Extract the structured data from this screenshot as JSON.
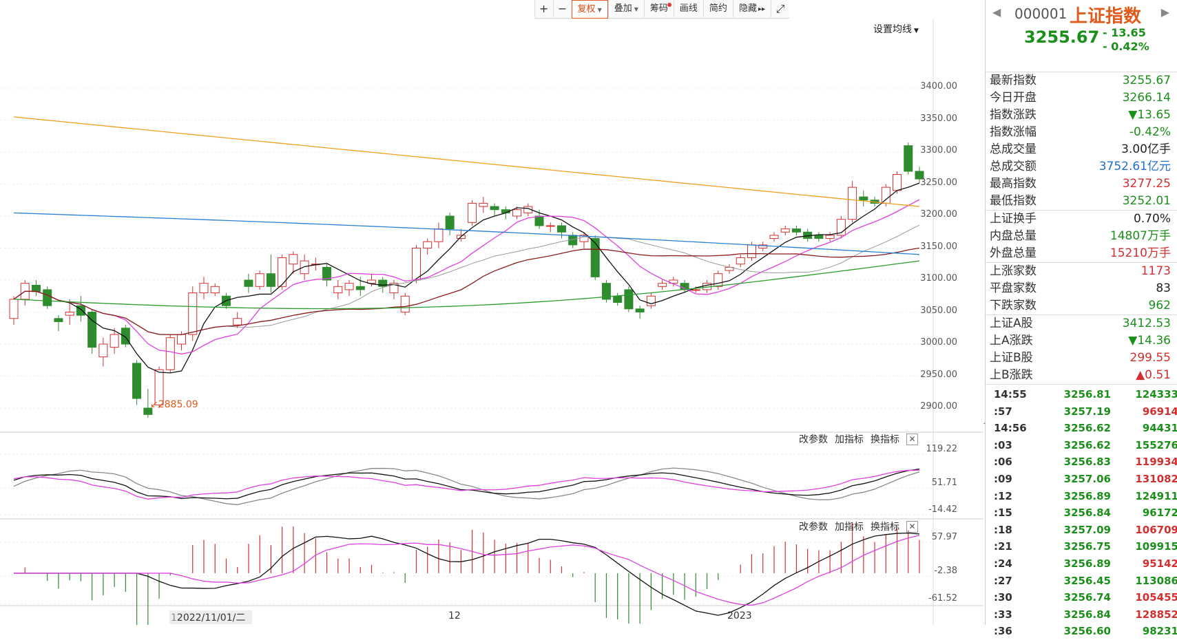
{
  "toolbar": {
    "plus": "+",
    "minus": "−",
    "items": [
      "复权",
      "叠加",
      "筹码",
      "画线",
      "简约",
      "隐藏"
    ],
    "more": "▸▸",
    "fullscreen": "⤢"
  },
  "ma_setting": "设置均线",
  "low_label": "2885.09",
  "main_axis": [
    "3400.00",
    "3350.00",
    "3300.00",
    "3250.00",
    "3200.00",
    "3150.00",
    "3100.00",
    "3050.00",
    "3000.00",
    "2950.00",
    "2900.00"
  ],
  "sub1": {
    "actions": [
      "改参数",
      "加指标",
      "换指标"
    ],
    "close": "✕",
    "axis": [
      "119.22",
      "51.71",
      "-14.42"
    ]
  },
  "sub2": {
    "actions": [
      "改参数",
      "加指标",
      "换指标"
    ],
    "close": "✕",
    "axis": [
      "57.97",
      "-2.38",
      "-61.52"
    ]
  },
  "dates": {
    "d1": "2022/11/01/二",
    "d2": "12",
    "d3": "2023",
    "d1_prefix": "1"
  },
  "side": {
    "code": "000001",
    "name": "上证指数",
    "price": "3255.67",
    "change": "- 13.65",
    "change_pct": "- 0.42%",
    "groups": [
      [
        {
          "label": "最新指数",
          "value": "3255.67",
          "color": "green"
        },
        {
          "label": "今日开盘",
          "value": "3266.14",
          "color": "green"
        },
        {
          "label": "指数涨跌",
          "value": "▼13.65",
          "color": "green"
        },
        {
          "label": "指数涨幅",
          "value": "-0.42%",
          "color": "green"
        },
        {
          "label": "总成交量",
          "value": "3.00亿手",
          "color": "dark"
        },
        {
          "label": "总成交额",
          "value": "3752.61亿元",
          "color": "blue"
        },
        {
          "label": "最高指数",
          "value": "3277.25",
          "color": "red"
        },
        {
          "label": "最低指数",
          "value": "3252.01",
          "color": "green"
        }
      ],
      [
        {
          "label": "上证换手",
          "value": "0.70%",
          "color": "dark"
        },
        {
          "label": "内盘总量",
          "value": "14807万手",
          "color": "green"
        },
        {
          "label": "外盘总量",
          "value": "15210万手",
          "color": "red"
        }
      ],
      [
        {
          "label": "上涨家数",
          "value": "1173",
          "color": "red"
        },
        {
          "label": "平盘家数",
          "value": "83",
          "color": "dark"
        },
        {
          "label": "下跌家数",
          "value": "962",
          "color": "green"
        }
      ],
      [
        {
          "label": "上证A股",
          "value": "3412.53",
          "color": "green"
        },
        {
          "label": "上A涨跌",
          "value": "▼14.36",
          "color": "green"
        },
        {
          "label": "上证B股",
          "value": "299.55",
          "color": "red"
        },
        {
          "label": "上B涨跌",
          "value": "▲0.51",
          "color": "red"
        }
      ]
    ],
    "ticks": [
      {
        "t": "14:55",
        "p": "3256.81",
        "v": "124333",
        "c": "green"
      },
      {
        "t": ":57",
        "p": "3257.19",
        "v": "96914",
        "c": "red"
      },
      {
        "t": "14:56",
        "p": "3256.62",
        "v": "94431",
        "c": "green"
      },
      {
        "t": ":03",
        "p": "3256.62",
        "v": "155276",
        "c": "green"
      },
      {
        "t": ":06",
        "p": "3256.83",
        "v": "119934",
        "c": "red"
      },
      {
        "t": ":09",
        "p": "3257.06",
        "v": "131082",
        "c": "red"
      },
      {
        "t": ":12",
        "p": "3256.89",
        "v": "124911",
        "c": "green"
      },
      {
        "t": ":15",
        "p": "3256.84",
        "v": "96172",
        "c": "green"
      },
      {
        "t": ":18",
        "p": "3257.09",
        "v": "106709",
        "c": "red"
      },
      {
        "t": ":21",
        "p": "3256.75",
        "v": "109915",
        "c": "green"
      },
      {
        "t": ":24",
        "p": "3256.89",
        "v": "95142",
        "c": "red"
      },
      {
        "t": ":27",
        "p": "3256.45",
        "v": "113086",
        "c": "green"
      },
      {
        "t": ":30",
        "p": "3256.74",
        "v": "105455",
        "c": "red"
      },
      {
        "t": ":33",
        "p": "3256.84",
        "v": "128852",
        "c": "red"
      },
      {
        "t": ":36",
        "p": "3256.60",
        "v": "98231",
        "c": "green"
      }
    ]
  },
  "colors": {
    "up": "#d32f2f",
    "down": "#2e8b2e",
    "ma5": "#111111",
    "ma10": "#e040e0",
    "ma20": "#999999",
    "ma30": "#8b1a1a",
    "ma60": "#2a9a2a",
    "ma120": "#2a7fd4",
    "ma250": "#f0a020"
  },
  "chart_data": {
    "type": "candlestick",
    "ylim": [
      2880,
      3420
    ],
    "candles": [
      [
        3040,
        3070,
        3030,
        3075
      ],
      [
        3070,
        3095,
        3060,
        3100
      ],
      [
        3092,
        3082,
        3075,
        3100
      ],
      [
        3085,
        3060,
        3055,
        3090
      ],
      [
        3040,
        3035,
        3020,
        3045
      ],
      [
        3045,
        3050,
        3030,
        3070
      ],
      [
        3060,
        3045,
        3035,
        3075
      ],
      [
        3050,
        2995,
        2985,
        3055
      ],
      [
        2980,
        3000,
        2965,
        3010
      ],
      [
        2995,
        3015,
        2985,
        3025
      ],
      [
        3025,
        3000,
        2995,
        3030
      ],
      [
        2970,
        2915,
        2905,
        2975
      ],
      [
        2900,
        2890,
        2885,
        2930
      ],
      [
        2905,
        2960,
        2900,
        2965
      ],
      [
        2960,
        3010,
        2955,
        3015
      ],
      [
        3000,
        3015,
        2990,
        3020
      ],
      [
        3015,
        3080,
        3005,
        3090
      ],
      [
        3080,
        3095,
        3070,
        3105
      ],
      [
        3080,
        3090,
        3075,
        3095
      ],
      [
        3075,
        3060,
        3055,
        3080
      ],
      [
        3030,
        3040,
        3025,
        3050
      ],
      [
        3100,
        3090,
        3080,
        3110
      ],
      [
        3090,
        3110,
        3085,
        3115
      ],
      [
        3110,
        3090,
        3080,
        3140
      ],
      [
        3090,
        3135,
        3085,
        3140
      ],
      [
        3125,
        3140,
        3110,
        3145
      ],
      [
        3110,
        3130,
        3100,
        3140
      ],
      [
        3125,
        3125,
        3115,
        3135
      ],
      [
        3120,
        3100,
        3090,
        3125
      ],
      [
        3080,
        3090,
        3070,
        3100
      ],
      [
        3085,
        3095,
        3075,
        3100
      ],
      [
        3090,
        3085,
        3075,
        3105
      ],
      [
        3095,
        3100,
        3090,
        3110
      ],
      [
        3100,
        3090,
        3080,
        3105
      ],
      [
        3080,
        3095,
        3070,
        3100
      ],
      [
        3050,
        3075,
        3045,
        3080
      ],
      [
        3100,
        3150,
        3095,
        3155
      ],
      [
        3150,
        3160,
        3140,
        3165
      ],
      [
        3160,
        3180,
        3150,
        3190
      ],
      [
        3200,
        3180,
        3170,
        3205
      ],
      [
        3165,
        3170,
        3160,
        3180
      ],
      [
        3190,
        3220,
        3185,
        3225
      ],
      [
        3215,
        3220,
        3205,
        3230
      ],
      [
        3215,
        3210,
        3200,
        3220
      ],
      [
        3210,
        3205,
        3195,
        3215
      ],
      [
        3200,
        3210,
        3195,
        3215
      ],
      [
        3205,
        3215,
        3200,
        3220
      ],
      [
        3200,
        3185,
        3180,
        3210
      ],
      [
        3185,
        3185,
        3175,
        3190
      ],
      [
        3185,
        3175,
        3165,
        3190
      ],
      [
        3170,
        3155,
        3150,
        3175
      ],
      [
        3160,
        3170,
        3150,
        3175
      ],
      [
        3165,
        3105,
        3100,
        3170
      ],
      [
        3095,
        3070,
        3065,
        3100
      ],
      [
        3075,
        3065,
        3060,
        3080
      ],
      [
        3085,
        3055,
        3050,
        3090
      ],
      [
        3055,
        3050,
        3040,
        3060
      ],
      [
        3060,
        3075,
        3055,
        3080
      ],
      [
        3090,
        3095,
        3085,
        3100
      ],
      [
        3095,
        3100,
        3090,
        3105
      ],
      [
        3095,
        3085,
        3080,
        3100
      ],
      [
        3085,
        3085,
        3080,
        3090
      ],
      [
        3085,
        3095,
        3080,
        3100
      ],
      [
        3090,
        3110,
        3085,
        3115
      ],
      [
        3115,
        3120,
        3110,
        3125
      ],
      [
        3125,
        3135,
        3120,
        3140
      ],
      [
        3135,
        3155,
        3130,
        3160
      ],
      [
        3150,
        3155,
        3145,
        3160
      ],
      [
        3165,
        3170,
        3160,
        3175
      ],
      [
        3175,
        3180,
        3170,
        3185
      ],
      [
        3180,
        3175,
        3170,
        3185
      ],
      [
        3175,
        3165,
        3160,
        3180
      ],
      [
        3170,
        3165,
        3160,
        3175
      ],
      [
        3165,
        3170,
        3160,
        3175
      ],
      [
        3170,
        3195,
        3165,
        3200
      ],
      [
        3195,
        3245,
        3190,
        3255
      ],
      [
        3230,
        3225,
        3215,
        3240
      ],
      [
        3225,
        3220,
        3215,
        3230
      ],
      [
        3220,
        3245,
        3215,
        3250
      ],
      [
        3240,
        3265,
        3235,
        3270
      ],
      [
        3310,
        3270,
        3265,
        3315
      ],
      [
        3270,
        3258,
        3252,
        3277
      ]
    ],
    "dates": [
      "2022/11/01/二",
      "12",
      "2023"
    ]
  }
}
